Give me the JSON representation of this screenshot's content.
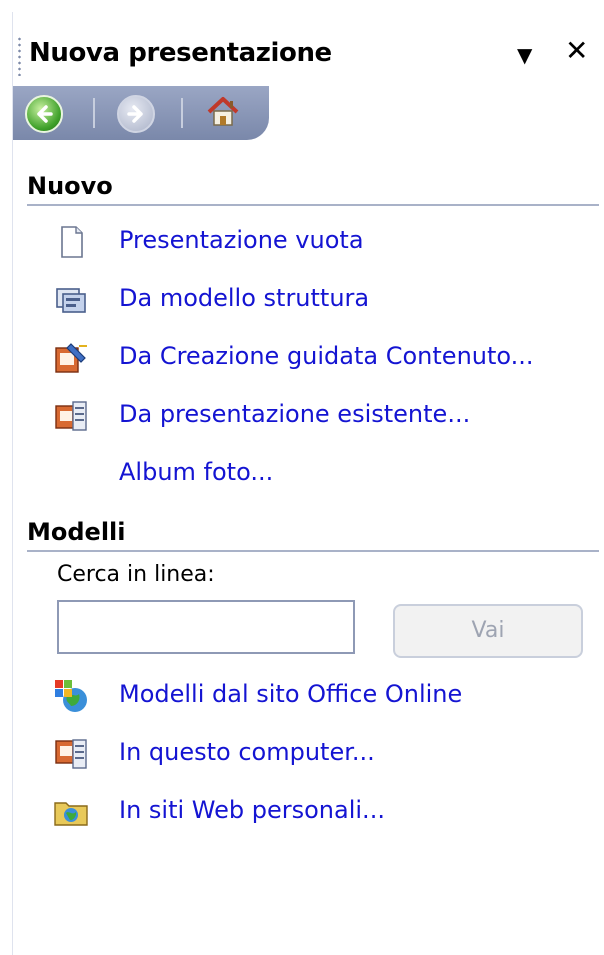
{
  "pane": {
    "title": "Nuova presentazione",
    "dropdown_glyph": "▼",
    "close_glyph": "✕"
  },
  "nav": {
    "back_icon": "back-arrow-icon",
    "forward_icon": "forward-arrow-icon",
    "home_icon": "home-icon"
  },
  "nuovo": {
    "heading": "Nuovo",
    "items": [
      {
        "label": "Presentazione vuota",
        "icon": "blank-page-icon"
      },
      {
        "label": "Da modello struttura",
        "icon": "design-template-icon"
      },
      {
        "label": "Da Creazione guidata Contenuto...",
        "icon": "wizard-icon"
      },
      {
        "label": "Da presentazione esistente...",
        "icon": "existing-presentation-icon"
      },
      {
        "label": "Album foto...",
        "icon": ""
      }
    ]
  },
  "modelli": {
    "heading": "Modelli",
    "search_label": "Cerca in linea:",
    "search_value": "",
    "go_label": "Vai",
    "items": [
      {
        "label": "Modelli dal sito Office Online",
        "icon": "office-online-globe-icon"
      },
      {
        "label": "In questo computer...",
        "icon": "computer-templates-icon"
      },
      {
        "label": "In siti Web personali...",
        "icon": "web-folder-icon"
      }
    ]
  }
}
